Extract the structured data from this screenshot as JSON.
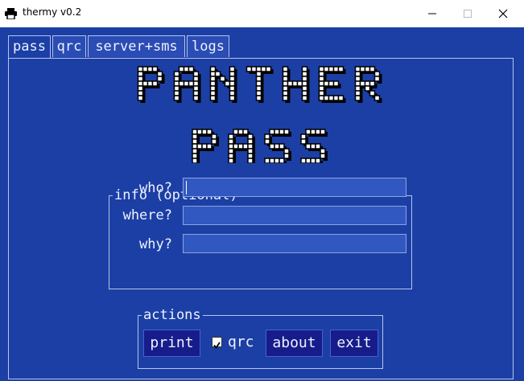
{
  "window": {
    "title": "thermy v0.2"
  },
  "tabs": [
    {
      "label": "pass",
      "active": true
    },
    {
      "label": "qrc",
      "active": false
    },
    {
      "label": "server+sms",
      "active": false
    },
    {
      "label": "logs",
      "active": false
    }
  ],
  "logo": {
    "line1": "PANTHER",
    "line2": "PASS"
  },
  "info": {
    "legend": "info (optional)",
    "fields": [
      {
        "label": "who?",
        "value": ""
      },
      {
        "label": "where?",
        "value": ""
      },
      {
        "label": "why?",
        "value": ""
      }
    ]
  },
  "actions": {
    "legend": "actions",
    "print_label": "print",
    "qrc_label": "qrc",
    "qrc_checked": true,
    "about_label": "about",
    "exit_label": "exit"
  },
  "colors": {
    "background": "#1c3fa5",
    "button": "#161c8a",
    "input": "#3058c0",
    "text": "#eef2ff"
  }
}
